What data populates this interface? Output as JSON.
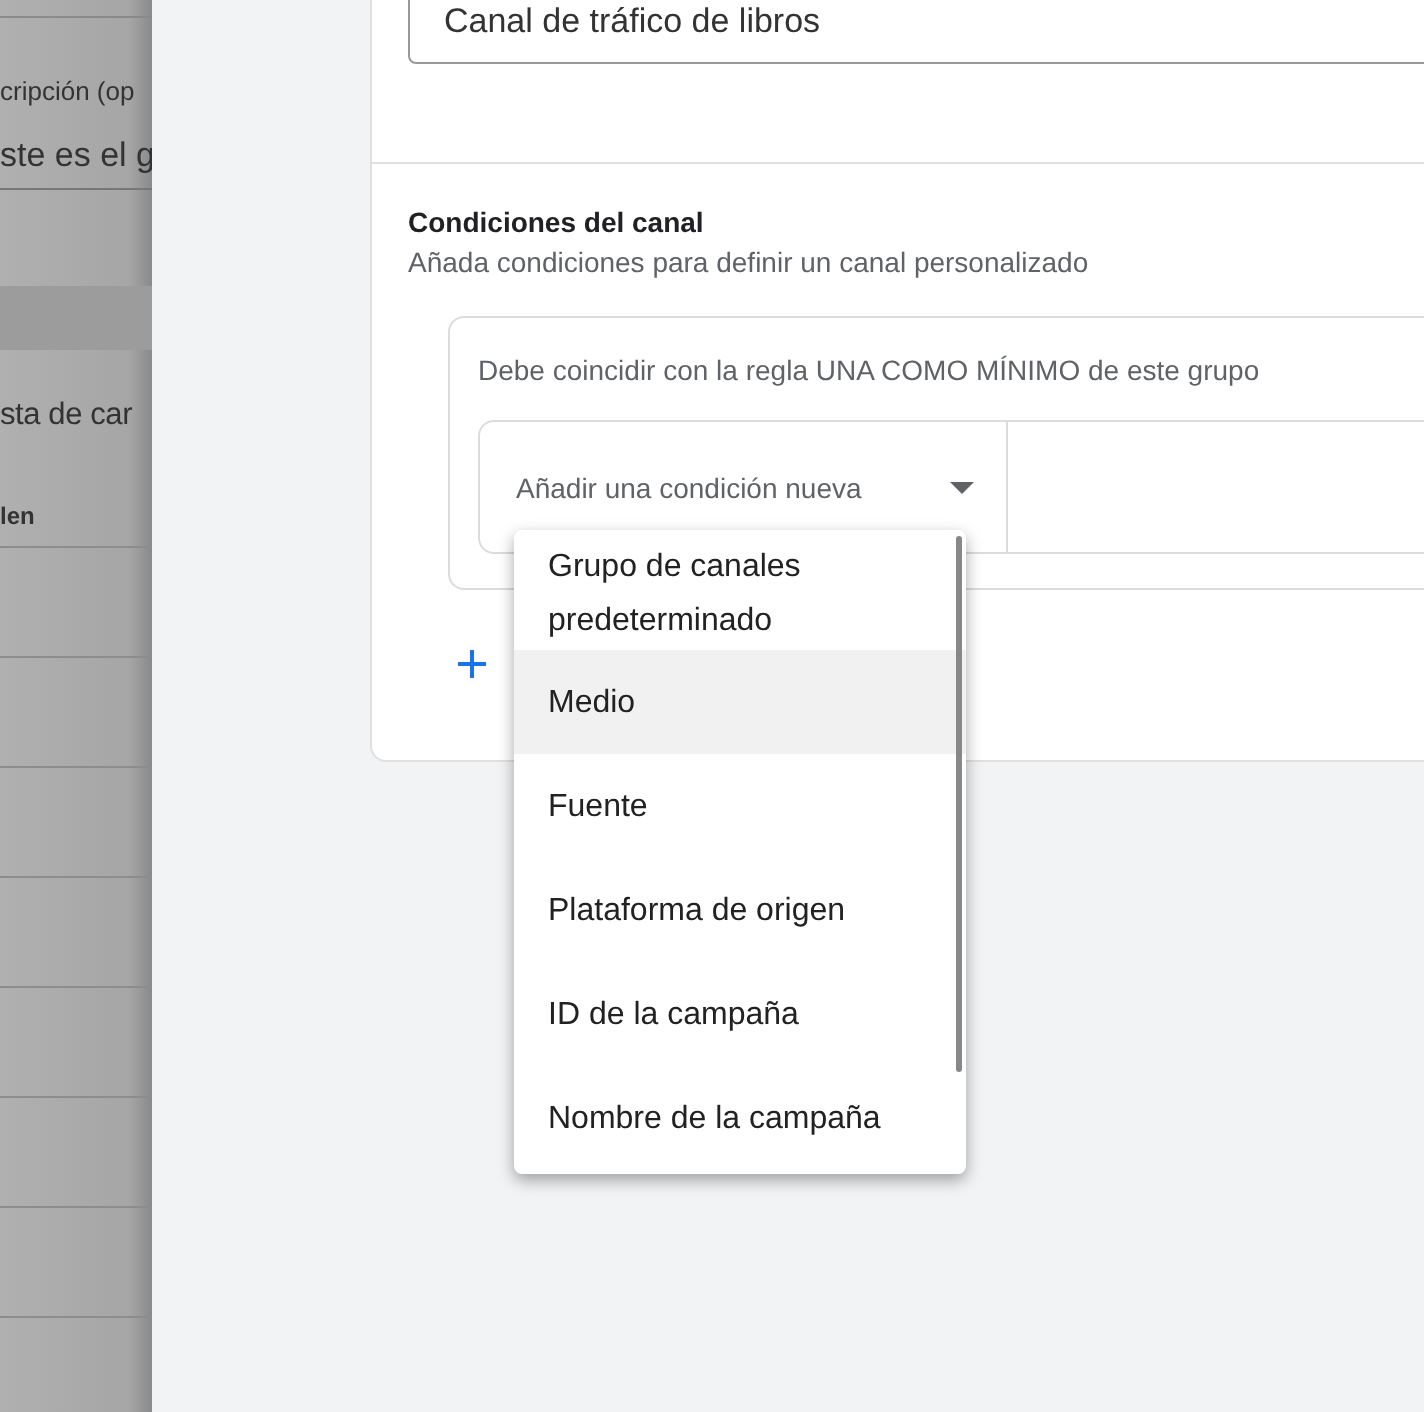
{
  "background_page": {
    "field_label": "cripción (op",
    "field_value": "ste es el g",
    "section_title": "sta de car",
    "column_header": "len"
  },
  "drawer": {
    "name_field": {
      "value": "Canal de tráfico de libros"
    },
    "conditions": {
      "title": "Condiciones del canal",
      "subtitle": "Añada condiciones para definir un canal personalizado",
      "group": {
        "rule": "Debe coincidir con la regla UNA COMO MÍNIMO de este grupo",
        "condition_dropdown": {
          "placeholder": "Añadir una condición nueva",
          "expanded": true,
          "options": [
            {
              "label": "Grupo de canales predeterminado",
              "selected": false
            },
            {
              "label": "Medio",
              "selected": true
            },
            {
              "label": "Fuente",
              "selected": false
            },
            {
              "label": "Plataforma de origen",
              "selected": false
            },
            {
              "label": "ID de la campaña",
              "selected": false
            },
            {
              "label": "Nombre de la campaña",
              "selected": false
            }
          ]
        }
      }
    }
  }
}
